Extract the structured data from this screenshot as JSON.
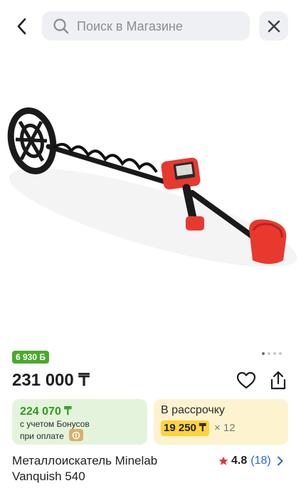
{
  "search": {
    "placeholder": "Поиск в Магазине"
  },
  "product": {
    "bonus_badge": "6 930 Б",
    "price": "231 000 ₸",
    "bonus_price": "224 070 ₸",
    "bonus_line1": "с учетом Бонусов",
    "bonus_line2": "при оплате",
    "installment_label": "В рассрочку",
    "installment_amount": "19 250 ₸",
    "installment_months": "× 12",
    "title_line1": "Металлоискатель Minelab",
    "title_line2": "Vanquish 540",
    "rating": "4.8",
    "reviews": "(18)"
  },
  "gallery": {
    "slides": 4,
    "active_index": 0
  },
  "colors": {
    "accent_green": "#2d9a1e",
    "badge_green": "#4aa92d",
    "installment_yellow": "#ffd33d",
    "rating_star": "#e2363a",
    "link_blue": "#2a6ad8"
  },
  "icons": [
    "back-arrow-icon",
    "search-icon",
    "close-icon",
    "heart-icon",
    "share-icon",
    "star-icon",
    "chevron-right-icon",
    "bonus-coin-icon"
  ]
}
